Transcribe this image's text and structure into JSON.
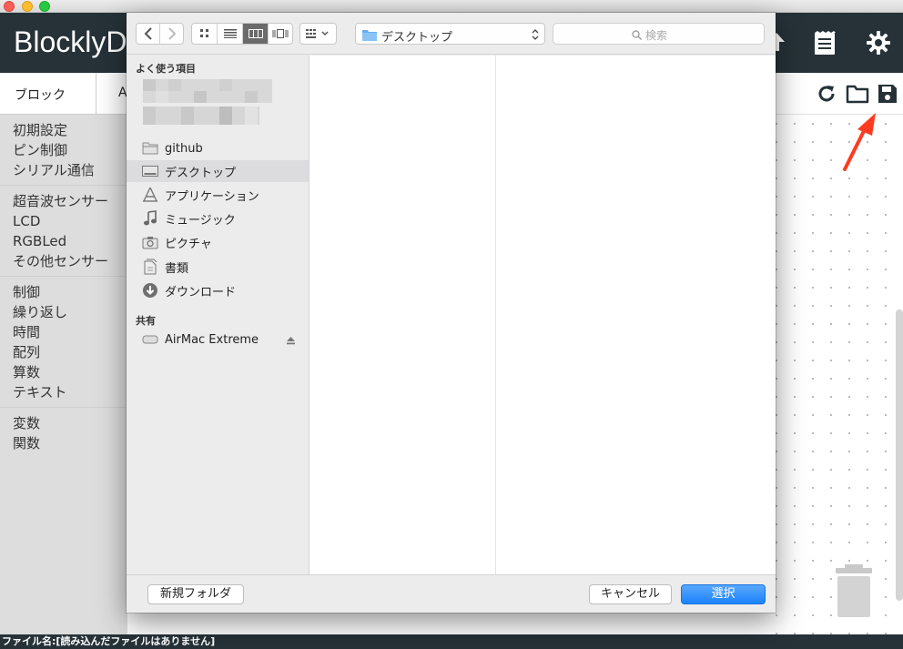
{
  "app": {
    "title": "BlocklyD",
    "tabs": [
      "ブロック",
      "A"
    ],
    "toolbox_groups": [
      [
        "初期設定",
        "ピン制御",
        "シリアル通信"
      ],
      [
        "超音波センサー",
        "LCD",
        "RGBLed",
        "その他センサー"
      ],
      [
        "制御",
        "繰り返し",
        "時間",
        "配列",
        "算数",
        "テキスト"
      ],
      [
        "変数",
        "関数"
      ]
    ],
    "header_icons": [
      "upload-icon",
      "notes-icon",
      "settings-gear-icon"
    ],
    "workspace_icons": [
      "refresh-icon",
      "open-folder-icon",
      "save-icon"
    ],
    "status_label": "ファイル名:",
    "status_value": "[読み込んだファイルはありません]"
  },
  "dialog": {
    "location": "デスクトップ",
    "search_placeholder": "検索",
    "favorites_heading": "よく使う項目",
    "favorites": [
      {
        "label": "github",
        "icon": "folder-icon"
      },
      {
        "label": "デスクトップ",
        "icon": "desktop-icon",
        "selected": true
      },
      {
        "label": "アプリケーション",
        "icon": "applications-icon"
      },
      {
        "label": "ミュージック",
        "icon": "music-icon"
      },
      {
        "label": "ピクチャ",
        "icon": "camera-icon"
      },
      {
        "label": "書類",
        "icon": "documents-icon"
      },
      {
        "label": "ダウンロード",
        "icon": "download-icon"
      }
    ],
    "shared_heading": "共有",
    "shared": [
      {
        "label": "AirMac Extreme",
        "icon": "drive-icon"
      }
    ],
    "new_folder_label": "新規フォルダ",
    "cancel_label": "キャンセル",
    "select_label": "選択"
  },
  "colors": {
    "header_bg": "#263238",
    "primary_button": "#1a82fb",
    "annotation_arrow": "#ff3b1f"
  }
}
